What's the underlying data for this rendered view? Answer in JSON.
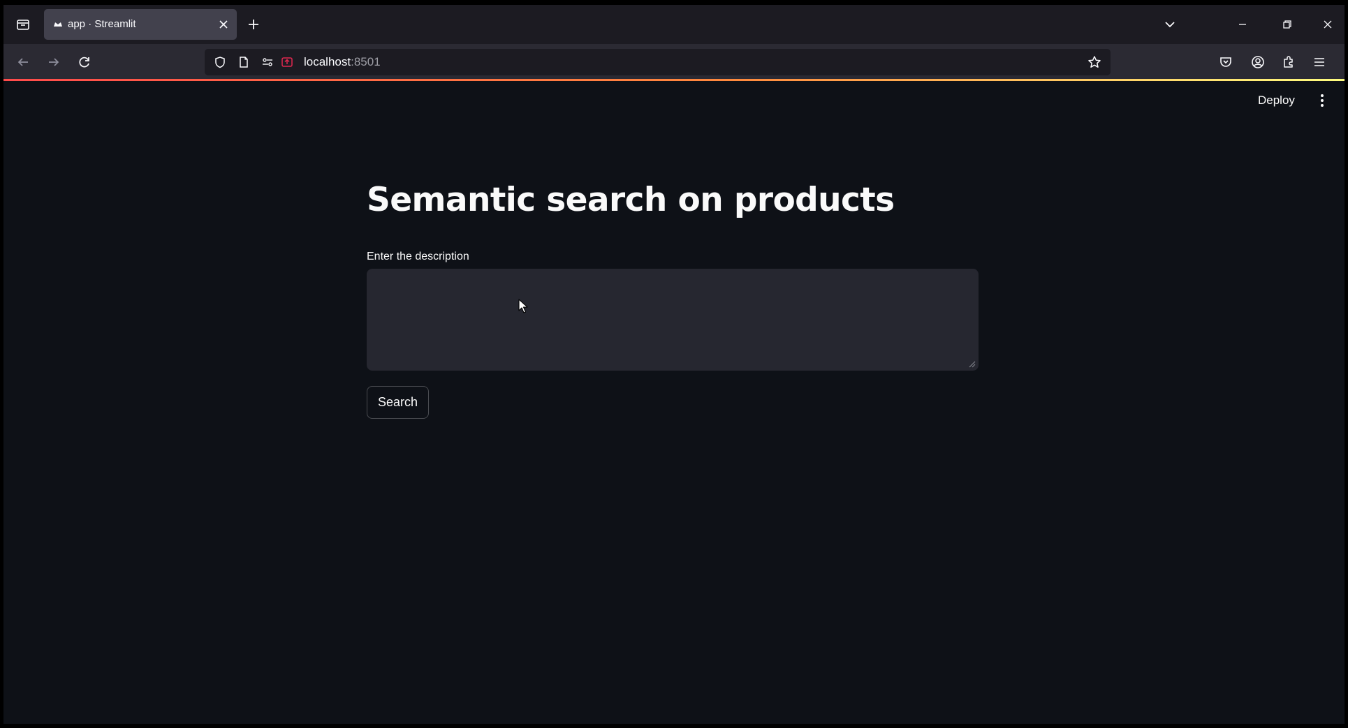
{
  "browser": {
    "tab": {
      "title": "app · Streamlit"
    },
    "url": {
      "host": "localhost",
      "port": ":8501"
    }
  },
  "app": {
    "deploy_label": "Deploy",
    "title": "Semantic search on products",
    "input": {
      "label": "Enter the description",
      "value": ""
    },
    "search_button": "Search"
  },
  "colors": {
    "background": "#0e1117",
    "text": "#fafafa",
    "input_background": "#262730",
    "accent": "#ff4b4b"
  }
}
